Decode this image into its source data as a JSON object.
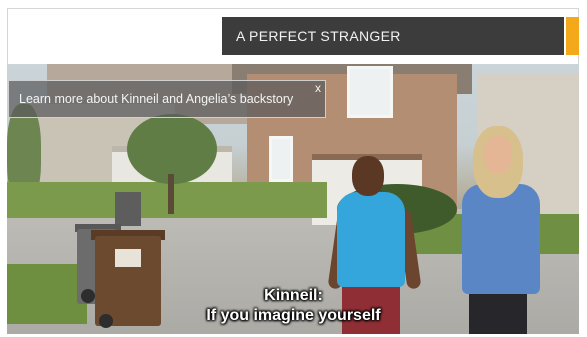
{
  "header": {
    "title": "A PERFECT STRANGER"
  },
  "info_popup": {
    "text": "Learn more about Kinneil and Angelia’s backstory",
    "close_label": "x"
  },
  "captions": {
    "speaker": "Kinneil:",
    "line": "If you imagine yourself"
  },
  "colors": {
    "title_bar": "#3c3c3c",
    "accent": "#f3a91a"
  }
}
